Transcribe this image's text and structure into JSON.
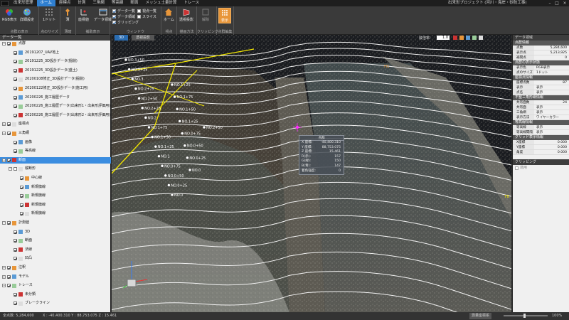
{
  "app": {
    "menu_tabs": [
      "出来形管理",
      "ホーム",
      "座標点",
      "計測",
      "三角網",
      "等高線",
      "断面",
      "メッシュ土量計算",
      "トレース"
    ],
    "window_title": "出来形プロジェクト (河川・海岸・砂防工事)"
  },
  "ribbon": {
    "groups": [
      {
        "label": "点群の表示",
        "buttons": [
          "RGB表示",
          "詳細設定"
        ]
      },
      {
        "label": "点のサイズ",
        "buttons": [
          "1ドット"
        ]
      },
      {
        "label": "薄暗",
        "buttons": [
          "薄"
        ]
      },
      {
        "label": "補助表示",
        "buttons": [
          "座標値",
          "データ領域"
        ]
      },
      {
        "label": "ウィンドウ",
        "checks": [
          {
            "label": "データ一覧",
            "checked": true
          },
          {
            "label": "データ領域",
            "checked": true
          },
          {
            "label": "クリッピング",
            "checked": true
          },
          {
            "label": "視点一覧",
            "checked": false
          },
          {
            "label": "スライス",
            "checked": false
          }
        ]
      },
      {
        "label": "視点",
        "buttons": [
          "ホーム"
        ]
      },
      {
        "label": "描画方法",
        "buttons": [
          "透視投影"
        ]
      },
      {
        "label": "クリッピング",
        "buttons": [
          "解除"
        ]
      },
      {
        "label": "点群編集",
        "buttons": [
          "表示"
        ]
      }
    ]
  },
  "left_panel": {
    "title": "データ一覧",
    "items": [
      {
        "label": "点群",
        "level": 0,
        "expander": "−",
        "checked": true
      },
      {
        "label": "20191207_UAV地上",
        "level": 1,
        "checked": true
      },
      {
        "label": "20191225_3D設計データ(掘削)",
        "level": 1,
        "checked": true
      },
      {
        "label": "20191225_3D設計データ(盛土)",
        "level": 1,
        "checked": true
      },
      {
        "label": "20200108修正_3D設計データ(掘削)",
        "level": 1,
        "checked": true
      },
      {
        "label": "20200122修正_3D設計データ(施工用)",
        "level": 1,
        "checked": true
      },
      {
        "label": "20200226_施工履歴データ",
        "level": 1,
        "checked": true
      },
      {
        "label": "20200226_施工履歴データ(出来形1・出来形評価用)",
        "level": 1,
        "checked": true
      },
      {
        "label": "20200226_施工履歴データ(出来形2・出来形評価用)",
        "level": 1,
        "checked": true
      },
      {
        "label": "座標点",
        "level": 0,
        "expander": "+",
        "checked": true
      },
      {
        "label": "三角網",
        "level": 0,
        "expander": "−",
        "checked": true
      },
      {
        "label": "画像",
        "level": 1,
        "checked": true
      },
      {
        "label": "等高線",
        "level": 1,
        "checked": true
      },
      {
        "label": "断面",
        "level": 0,
        "expander": "−",
        "checked": true,
        "selected": true
      },
      {
        "label": "縦断形",
        "level": 1,
        "expander": "−",
        "checked": false
      },
      {
        "label": "中心線",
        "level": 2,
        "checked": true
      },
      {
        "label": "新規旗線",
        "level": 2,
        "checked": true
      },
      {
        "label": "新規旗線",
        "level": 2,
        "checked": true
      },
      {
        "label": "新規旗線",
        "level": 2,
        "checked": true
      },
      {
        "label": "新規旗線",
        "level": 2,
        "checked": true
      },
      {
        "label": "計測値",
        "level": 0,
        "expander": "−",
        "checked": true
      },
      {
        "label": "3D",
        "level": 1,
        "checked": true
      },
      {
        "label": "断面",
        "level": 1,
        "checked": true
      },
      {
        "label": "法線",
        "level": 1,
        "checked": true
      },
      {
        "label": "凹凸",
        "level": 1,
        "checked": true
      },
      {
        "label": "注釈",
        "level": 0,
        "expander": "+",
        "checked": true
      },
      {
        "label": "モデル",
        "level": 0,
        "expander": "+",
        "checked": true
      },
      {
        "label": "トレース",
        "level": 0,
        "expander": "−",
        "checked": true
      },
      {
        "label": "未分類",
        "level": 1,
        "checked": true
      },
      {
        "label": "ブレークライン",
        "level": 1,
        "checked": true
      }
    ]
  },
  "viewport": {
    "tabs": [
      "3D",
      "透視投影"
    ],
    "scale_label": "縦倍率:",
    "scale_value": "1.0",
    "marker_h1": "H1",
    "marker_t8": "T8",
    "station_labels": [
      "NO.3+50",
      "NO.3+25",
      "NO.3",
      "NO.2+75",
      "NO.2+50",
      "NO.2+25",
      "NO.2",
      "NO.1+75",
      "NO.1+50",
      "NO.1+25",
      "NO.1",
      "NO.0+75",
      "NO.0+50",
      "NO.0+25",
      "NO.0",
      "NO.1+25",
      "NO.1+75",
      "NO.1+50",
      "NO.1+25",
      "NO.0+75",
      "NO.0+50",
      "NO.0+25",
      "NO.0",
      "NO.2+50"
    ],
    "popup": {
      "title": "点群",
      "rows": [
        {
          "k": "X 座標:",
          "v": "-40,400.310"
        },
        {
          "k": "Y 座標:",
          "v": "88,753.075"
        },
        {
          "k": "Z 座標:",
          "v": "15.461"
        },
        {
          "k": "R(赤):",
          "v": "157"
        },
        {
          "k": "G(緑):",
          "v": "150"
        },
        {
          "k": "B(青):",
          "v": "147"
        },
        {
          "k": "着色強度:",
          "v": "0"
        }
      ]
    }
  },
  "right_panel": {
    "title": "データ領域",
    "sections": [
      {
        "title": "点群情報",
        "rows": [
          [
            "点数",
            "5,284,600"
          ],
          [
            "表示点",
            "5,213,925"
          ],
          [
            "補間点",
            "0"
          ]
        ]
      },
      {
        "title": "点群の表示状態",
        "rows": [
          [
            "表示色",
            "RGB表示",
            "left"
          ],
          [
            "点のサイズ",
            "1ドット",
            "left"
          ]
        ]
      },
      {
        "title": "座標点情報",
        "rows": [
          [
            "座標点数",
            "87"
          ],
          [
            "表示",
            "表示",
            "left"
          ],
          [
            "点名",
            "表示",
            "left"
          ]
        ]
      },
      {
        "title": "不整三角形網情報",
        "rows": [
          [
            "共有面数",
            "24"
          ],
          [
            "共有面",
            "表示",
            "left"
          ],
          [
            "三角網",
            "表示",
            "left"
          ],
          [
            "表示方法",
            "ワイヤーカラー",
            "left"
          ]
        ]
      },
      {
        "title": "等高線情報",
        "rows": [
          [
            "等高線",
            "表示",
            "left"
          ],
          [
            "等高線間隔",
            "表示",
            "left"
          ]
        ]
      },
      {
        "title": "グリッド表示情報",
        "rows": [
          [
            "X座標",
            "0.000"
          ],
          [
            "Y座標",
            "0.000"
          ],
          [
            "角度",
            "0.000"
          ]
        ]
      }
    ],
    "clipping_title": "クリッピング",
    "clipping_apply": "適用"
  },
  "status": {
    "points": "全点数: 5,284,600",
    "coords": "X : -40,400.310   Y : 88,753.075   Z : 15.461",
    "mode": "測量座標系",
    "zoom": "100%"
  },
  "colors": {
    "accent": "#2f7fd0",
    "selection": "#3b8de0",
    "alignment": "#f2e600",
    "ribbon_active": "#e8963a"
  }
}
